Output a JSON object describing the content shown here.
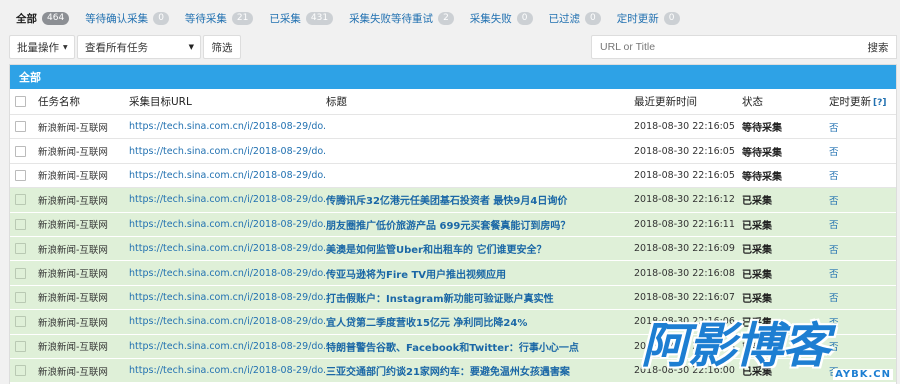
{
  "tabs": [
    {
      "label": "全部",
      "count": "464",
      "current": true
    },
    {
      "label": "等待确认采集",
      "count": "0"
    },
    {
      "label": "等待采集",
      "count": "21"
    },
    {
      "label": "已采集",
      "count": "431"
    },
    {
      "label": "采集失败等待重试",
      "count": "2"
    },
    {
      "label": "采集失败",
      "count": "0"
    },
    {
      "label": "已过滤",
      "count": "0"
    },
    {
      "label": "定时更新",
      "count": "0"
    }
  ],
  "toolbar": {
    "bulk_label": "批量操作",
    "task_select": "查看所有任务",
    "filter_label": "筛选",
    "search_placeholder": "URL or Title",
    "search_label": "搜索"
  },
  "panel": {
    "title": "全部",
    "columns": {
      "name": "任务名称",
      "url": "采集目标URL",
      "title": "标题",
      "time": "最近更新时间",
      "status": "状态",
      "timer": "定时更新",
      "help": "[?]"
    },
    "rows": [
      {
        "name": "新浪新闻-互联网",
        "url": "https://tech.sina.com.cn/i/2018-08-29/do...",
        "title": "",
        "time": "2018-08-30 22:16:05",
        "status": "等待采集",
        "timer": "否",
        "done": false
      },
      {
        "name": "新浪新闻-互联网",
        "url": "https://tech.sina.com.cn/i/2018-08-29/do...",
        "title": "",
        "time": "2018-08-30 22:16:05",
        "status": "等待采集",
        "timer": "否",
        "done": false
      },
      {
        "name": "新浪新闻-互联网",
        "url": "https://tech.sina.com.cn/i/2018-08-29/do...",
        "title": "",
        "time": "2018-08-30 22:16:05",
        "status": "等待采集",
        "timer": "否",
        "done": false
      },
      {
        "name": "新浪新闻-互联网",
        "url": "https://tech.sina.com.cn/i/2018-08-29/do...",
        "title": "传腾讯斥32亿港元任美团基石投资者 最快9月4日询价",
        "time": "2018-08-30 22:16:12",
        "status": "已采集",
        "timer": "否",
        "done": true
      },
      {
        "name": "新浪新闻-互联网",
        "url": "https://tech.sina.com.cn/i/2018-08-29/do...",
        "title": "朋友圈推广低价旅游产品 699元买套餐真能订到房吗？",
        "time": "2018-08-30 22:16:11",
        "status": "已采集",
        "timer": "否",
        "done": true
      },
      {
        "name": "新浪新闻-互联网",
        "url": "https://tech.sina.com.cn/i/2018-08-29/do...",
        "title": "美澳是如何监管Uber和出租车的 它们谁更安全？",
        "time": "2018-08-30 22:16:09",
        "status": "已采集",
        "timer": "否",
        "done": true
      },
      {
        "name": "新浪新闻-互联网",
        "url": "https://tech.sina.com.cn/i/2018-08-29/do...",
        "title": "传亚马逊将为Fire TV用户推出视频应用",
        "time": "2018-08-30 22:16:08",
        "status": "已采集",
        "timer": "否",
        "done": true
      },
      {
        "name": "新浪新闻-互联网",
        "url": "https://tech.sina.com.cn/i/2018-08-29/do...",
        "title": "打击假账户：Instagram新功能可验证账户真实性",
        "time": "2018-08-30 22:16:07",
        "status": "已采集",
        "timer": "否",
        "done": true
      },
      {
        "name": "新浪新闻-互联网",
        "url": "https://tech.sina.com.cn/i/2018-08-29/do...",
        "title": "宜人贷第二季度营收15亿元 净利同比降24%",
        "time": "2018-08-30 22:16:06",
        "status": "已采集",
        "timer": "否",
        "done": true
      },
      {
        "name": "新浪新闻-互联网",
        "url": "https://tech.sina.com.cn/i/2018-08-29/do...",
        "title": "特朗普警告谷歌、Facebook和Twitter：行事小心一点",
        "time": "2018-08-30 22:16:04",
        "status": "已采集",
        "timer": "否",
        "done": true
      },
      {
        "name": "新浪新闻-互联网",
        "url": "https://tech.sina.com.cn/i/2018-08-29/do...",
        "title": "三亚交通部门约谈21家网约车：要避免温州女孩遇害案",
        "time": "2018-08-30 22:16:00",
        "status": "已采集",
        "timer": "否",
        "done": true
      }
    ]
  },
  "watermark": {
    "brand": "阿影博客",
    "domain": "AYBK.CN"
  }
}
